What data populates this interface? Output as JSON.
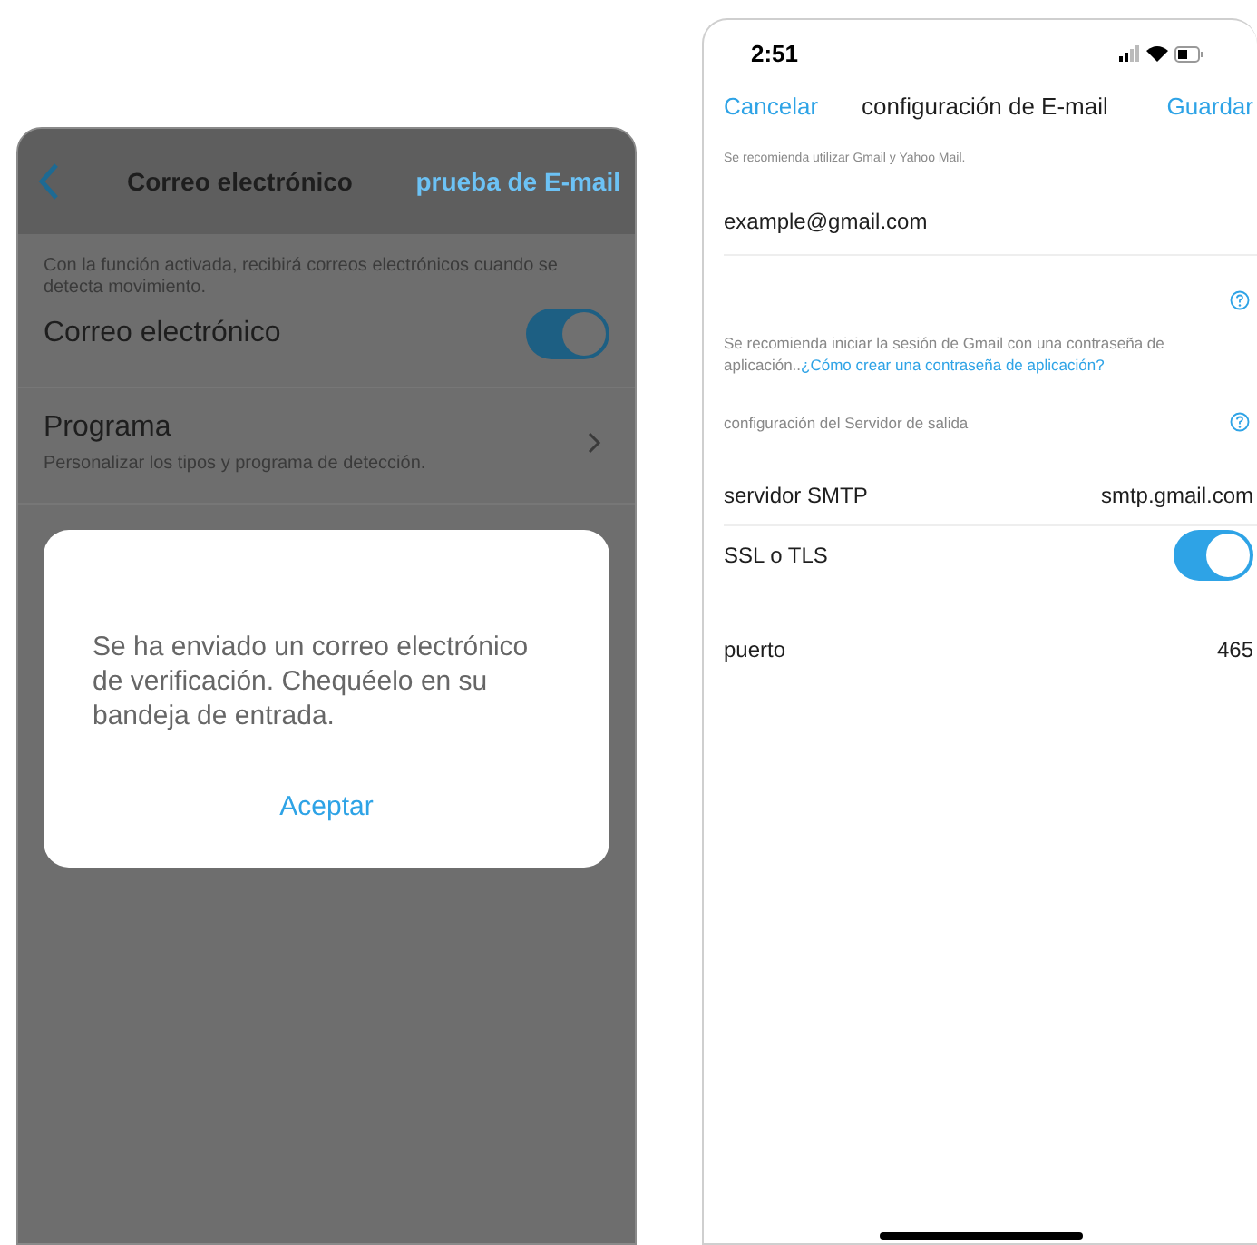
{
  "left_screen": {
    "nav": {
      "title": "Correo electrónico",
      "action": "prueba de E-mail"
    },
    "description": "Con la función activada, recibirá correos electrónicos cuando se detecta movimiento.",
    "email_toggle": {
      "label": "Correo electrónico",
      "on": true
    },
    "schedule": {
      "title": "Programa",
      "subtitle": "Personalizar los tipos y programa de detección."
    },
    "dialog": {
      "message": "Se ha enviado un correo electrónico de verificación. Chequéelo en su bandeja de entrada.",
      "button": "Aceptar"
    }
  },
  "right_screen": {
    "status_bar": {
      "time": "2:51"
    },
    "nav": {
      "cancel": "Cancelar",
      "title": "configuración de E-mail",
      "save": "Guardar"
    },
    "hint": "Se recomienda utilizar Gmail y Yahoo Mail.",
    "email_field": {
      "value": "example@gmail.com"
    },
    "app_password_note": {
      "text": "Se recomienda iniciar la sesión de Gmail con una contraseña de aplicación..",
      "link": "¿Cómo crear una contraseña de aplicación?"
    },
    "server_section": {
      "heading": "configuración del Servidor de salida"
    },
    "rows": [
      {
        "kind": "value",
        "label": "servidor SMTP",
        "value": "smtp.gmail.com"
      },
      {
        "kind": "toggle",
        "label": "SSL o TLS",
        "on": true
      },
      {
        "kind": "value",
        "label": "puerto",
        "value": "465"
      }
    ]
  }
}
